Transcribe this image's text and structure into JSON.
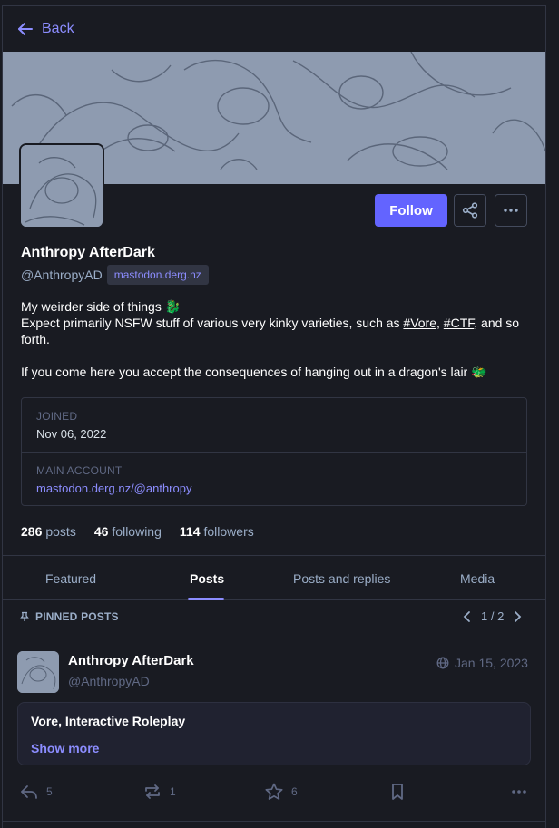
{
  "nav": {
    "back_label": "Back"
  },
  "profile": {
    "display_name": "Anthropy AfterDark",
    "handle": "@AnthropyAD",
    "domain": "mastodon.derg.nz",
    "follow_label": "Follow",
    "bio": {
      "line1": "My weirder side of things 🐉",
      "line2_prefix": "Expect primarily NSFW stuff of various very kinky varieties, such as ",
      "tag1": "#Vore",
      "sep": ", ",
      "tag2": "#CTF",
      "line2_suffix": ", and so forth.",
      "line3": "If you come here you accept the consequences of hanging out in a dragon's lair 🐲"
    },
    "fields": [
      {
        "label": "JOINED",
        "value": "Nov 06, 2022"
      },
      {
        "label": "MAIN ACCOUNT",
        "value": "mastodon.derg.nz/@anthropy"
      }
    ],
    "counts": {
      "posts": "286",
      "posts_label": "posts",
      "following": "46",
      "following_label": "following",
      "followers": "114",
      "followers_label": "followers"
    }
  },
  "tabs": [
    "Featured",
    "Posts",
    "Posts and replies",
    "Media"
  ],
  "pinned": {
    "header": "PINNED POSTS",
    "pager": "1 / 2"
  },
  "post": {
    "author": "Anthropy AfterDark",
    "handle": "@AnthropyAD",
    "date": "Jan 15, 2023",
    "content_warning": "Vore, Interactive Roleplay",
    "show_more": "Show more",
    "replies": "5",
    "boosts": "1",
    "favourites": "6"
  },
  "colors": {
    "accent": "#6364ff",
    "link": "#8c8dff",
    "background": "#191b22",
    "muted": "#9baec8"
  }
}
